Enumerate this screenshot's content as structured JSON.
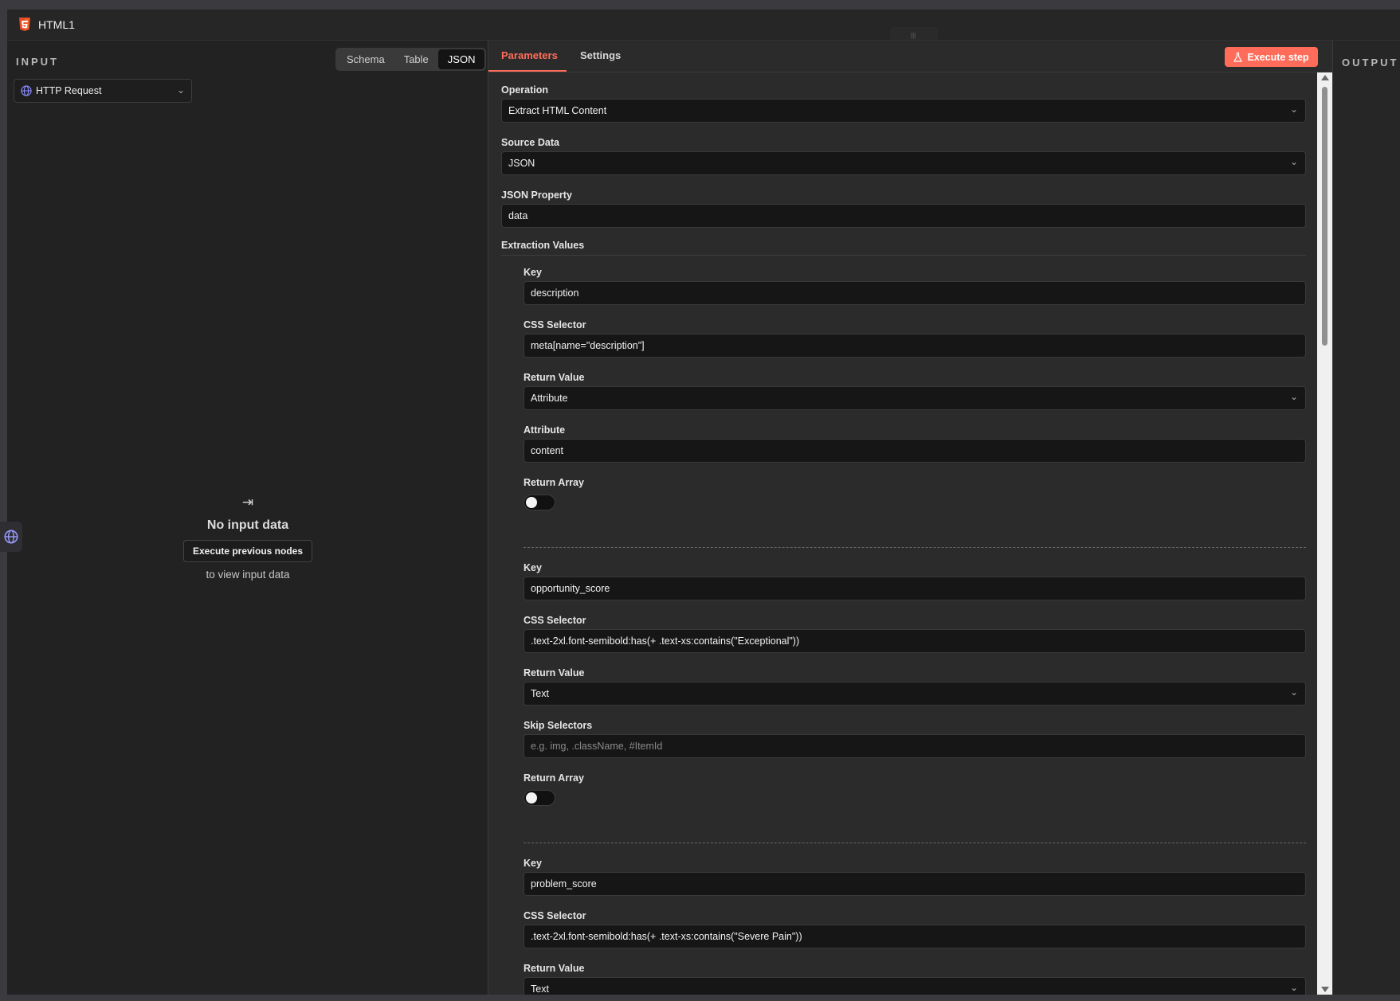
{
  "window": {
    "title": "HTML1"
  },
  "input_panel": {
    "label": "INPUT",
    "view_tabs": [
      "Schema",
      "Table",
      "JSON"
    ],
    "active_view": "JSON",
    "node_select": "HTTP Request",
    "empty": {
      "heading": "No input data",
      "button": "Execute previous nodes",
      "sub": "to view input data"
    }
  },
  "output_panel": {
    "label": "OUTPUT"
  },
  "tabs": {
    "parameters": "Parameters",
    "settings": "Settings"
  },
  "execute_button": "Execute step",
  "form": {
    "operation": {
      "label": "Operation",
      "value": "Extract HTML Content"
    },
    "source_data": {
      "label": "Source Data",
      "value": "JSON"
    },
    "json_property": {
      "label": "JSON Property",
      "value": "data"
    },
    "extraction_values_label": "Extraction Values",
    "items": [
      {
        "key_label": "Key",
        "key": "description",
        "css_label": "CSS Selector",
        "css": "meta[name=\"description\"]",
        "rv_label": "Return Value",
        "rv": "Attribute",
        "extra_label": "Attribute",
        "extra": "content",
        "ra_label": "Return Array"
      },
      {
        "key_label": "Key",
        "key": "opportunity_score",
        "css_label": "CSS Selector",
        "css": ".text-2xl.font-semibold:has(+ .text-xs:contains(\"Exceptional\"))",
        "rv_label": "Return Value",
        "rv": "Text",
        "extra_label": "Skip Selectors",
        "extra_placeholder": "e.g. img, .className, #ItemId",
        "ra_label": "Return Array"
      },
      {
        "key_label": "Key",
        "key": "problem_score",
        "css_label": "CSS Selector",
        "css": ".text-2xl.font-semibold:has(+ .text-xs:contains(\"Severe Pain\"))",
        "rv_label": "Return Value",
        "rv": "Text"
      }
    ]
  },
  "colors": {
    "accent": "#ff6d5a",
    "background": "#2b2b2b",
    "field": "#161616"
  }
}
